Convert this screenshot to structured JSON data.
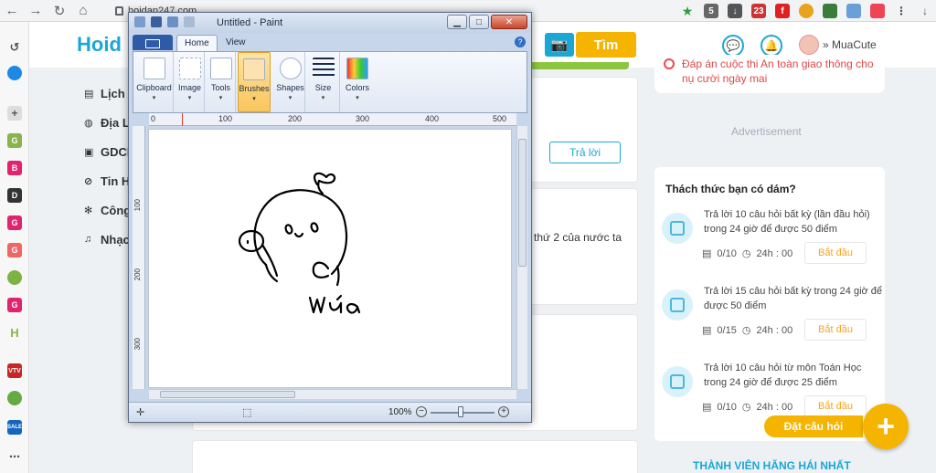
{
  "browser": {
    "url": "hoidap247.com"
  },
  "site": {
    "logo_primary": "Hoid",
    "search_label": "Tìm",
    "username": "MuaCute"
  },
  "left_nav": {
    "items": [
      {
        "label": "Lịch S",
        "icon": "book-icon"
      },
      {
        "label": "Địa Lý",
        "icon": "globe-icon"
      },
      {
        "label": "GDCD",
        "icon": "law-icon"
      },
      {
        "label": "Tin H",
        "icon": "computer-icon"
      },
      {
        "label": "Công",
        "icon": "tools-icon"
      },
      {
        "label": "Nhạc",
        "icon": "music-icon"
      }
    ]
  },
  "center": {
    "answer_label": "Trả lời",
    "question_snippet": "n thứ 2 của nước ta"
  },
  "right": {
    "top_notice": "Đáp án cuộc thi An toàn giao thông cho nụ cười ngày mai",
    "advertisement": "Advertisement",
    "challenge_title": "Thách thức bạn có dám?",
    "challenges": [
      {
        "text": "Trả lời 10 câu hỏi  bất kỳ (lần đầu hỏi) trong 24 giờ để được 50 điểm",
        "progress": "0/10",
        "time": "24h : 00",
        "start": "Bắt đầu"
      },
      {
        "text": "Trả lời 15 câu hỏi  bất kỳ  trong 24 giờ để được 50 điểm",
        "progress": "0/15",
        "time": "24h : 00",
        "start": "Bắt đầu"
      },
      {
        "text": "Trả lời 10 câu hỏi  từ môn Toán Học trong 24 giờ để được 25 điểm",
        "progress": "0/10",
        "time": "24h : 00",
        "start": "Bắt đầu"
      }
    ],
    "ask_label": "Đặt câu hỏi",
    "plus_label": "+",
    "members_title": "THÀNH VIÊN HĂNG HÁI NHẤT"
  },
  "paint": {
    "title": "Untitled - Paint",
    "tabs": [
      "Home",
      "View"
    ],
    "groups": [
      "Clipboard",
      "Image",
      "Tools",
      "Brushes",
      "Shapes",
      "Size",
      "Colors"
    ],
    "ruler_top": [
      "0",
      "100",
      "200",
      "300",
      "400",
      "500"
    ],
    "ruler_left": [
      "100",
      "200",
      "300"
    ],
    "drawing_text": "Mưa",
    "zoom": "100%"
  },
  "colors": {
    "accent": "#1aa7d6",
    "brand_yellow": "#f5b400",
    "notice_red": "#e04848"
  }
}
